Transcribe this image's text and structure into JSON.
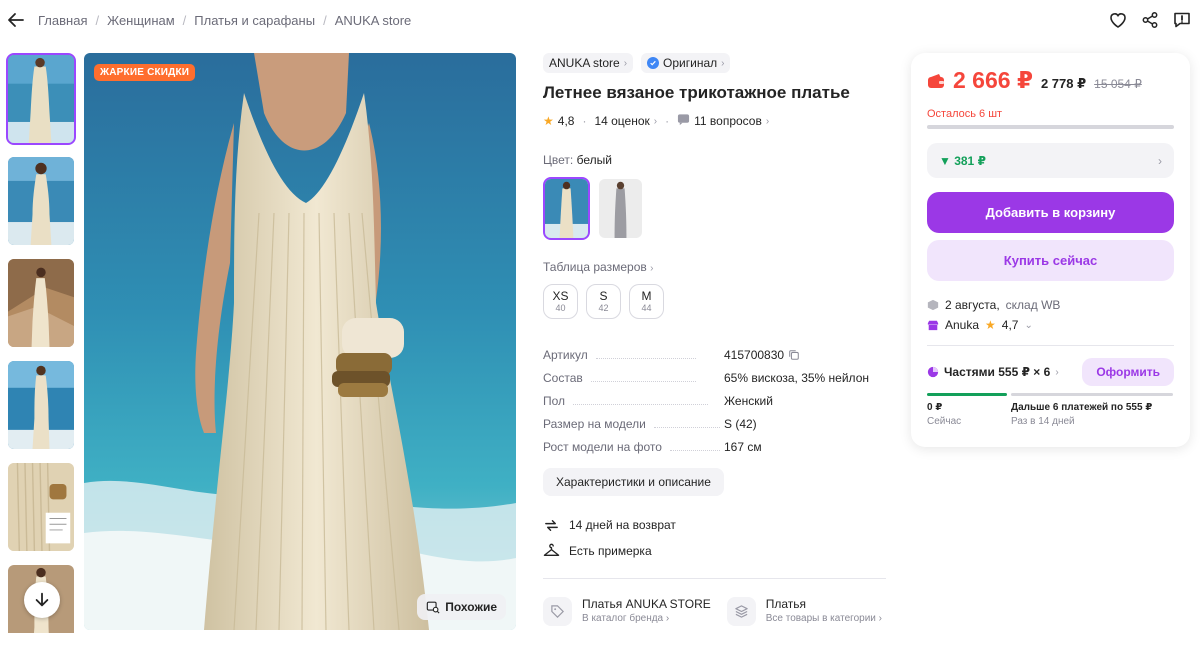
{
  "breadcrumbs": [
    "Главная",
    "Женщинам",
    "Платья и сарафаны",
    "ANUKA store"
  ],
  "icons": {
    "back": "arrow-left-icon",
    "favorite": "heart-icon",
    "share": "share-icon",
    "report": "chat-alert-icon"
  },
  "gallery": {
    "badge": "ЖАРКИЕ СКИДКИ",
    "similar_label": "Похожие"
  },
  "product": {
    "brand": "ANUKA store",
    "original_label": "Оригинал",
    "title": "Летнее вязаное трикотажное платье",
    "rating": "4,8",
    "reviews": "14 оценок",
    "questions": "11 вопросов",
    "color_label": "Цвет:",
    "color_value": "белый",
    "size_table_label": "Таблица размеров",
    "sizes": [
      {
        "label": "XS",
        "num": "40"
      },
      {
        "label": "S",
        "num": "42"
      },
      {
        "label": "M",
        "num": "44"
      }
    ],
    "specs": [
      {
        "key": "Артикул",
        "value": "415700830"
      },
      {
        "key": "Состав",
        "value": "65% вискоза, 35% нейлон"
      },
      {
        "key": "Пол",
        "value": "Женский"
      },
      {
        "key": "Размер на модели",
        "value": "S (42)"
      },
      {
        "key": "Рост модели на фото",
        "value": "167 см"
      }
    ],
    "details_button": "Характеристики и описание",
    "perks": [
      "14 дней на возврат",
      "Есть примерка"
    ],
    "links": [
      {
        "title": "Платья ANUKA STORE",
        "sub": "В каталог бренда"
      },
      {
        "title": "Платья",
        "sub": "Все товары в категории"
      }
    ]
  },
  "price_card": {
    "price": "2 666 ₽",
    "price_wallet": "2 778 ₽",
    "price_old": "15 054 ₽",
    "stock_text": "Осталось 6 шт",
    "stock_remaining_fraction": 0.0,
    "cashback": "▼ 381 ₽",
    "add_to_cart": "Добавить в корзину",
    "buy_now": "Купить сейчас",
    "delivery": "2 августа,",
    "warehouse": "склад WB",
    "seller": "Anuka",
    "seller_rating": "4,7",
    "installments_label": "Частями 555 ₽ × 6",
    "installments_button": "Оформить",
    "plan": [
      {
        "amount": "0 ₽",
        "when": "Сейчас"
      },
      {
        "amount": "Дальше 6 платежей по 555 ₽",
        "when": "Раз в 14 дней"
      }
    ]
  },
  "colors": {
    "accent": "#9b38e6",
    "accent_light": "#f1e5fc",
    "price_red": "#f5463b",
    "badge_orange": "#ff6e2e",
    "cashback_green": "#13a05a"
  }
}
